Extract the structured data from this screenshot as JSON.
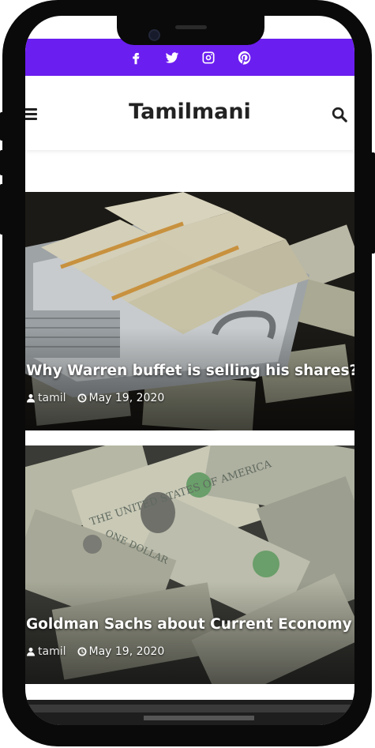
{
  "social": {
    "items": [
      {
        "name": "facebook-icon"
      },
      {
        "name": "twitter-icon"
      },
      {
        "name": "instagram-icon"
      },
      {
        "name": "pinterest-icon"
      }
    ],
    "bar_color": "#6b1ef0"
  },
  "header": {
    "title": "Tamilmani"
  },
  "posts": [
    {
      "title": "Why Warren buffet is selling his shares?",
      "author": "tamil",
      "date": "May 19, 2020"
    },
    {
      "title": "Goldman Sachs about Current Economy",
      "author": "tamil",
      "date": "May 19, 2020"
    }
  ]
}
